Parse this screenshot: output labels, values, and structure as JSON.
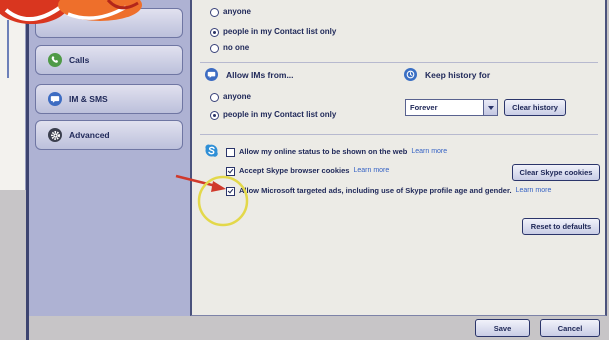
{
  "colors": {
    "window_frame": "#3d4470",
    "sidebar_bg": "#aeb2d3",
    "main_bg": "#ecebe6",
    "footer_bg": "#c7c5c7",
    "text": "#212a5a",
    "link": "#3562c4",
    "button_border": "#2b356a",
    "annotation_arrow": "#d0392b",
    "annotation_circle": "#e3d84a",
    "logo_red": "#d9361f",
    "logo_orange": "#ee6f2b"
  },
  "sidebar": {
    "items": [
      {
        "label": "Calls",
        "icon": "phone-icon",
        "icon_color": "#4f9a47"
      },
      {
        "label": "IM & SMS",
        "icon": "chat-icon",
        "icon_color": "#3d6cc2"
      },
      {
        "label": "Advanced",
        "icon": "gear-icon",
        "icon_color": "#3b3f4e"
      }
    ]
  },
  "privacy": {
    "contact_group": {
      "options": [
        {
          "label": "anyone",
          "selected": false
        },
        {
          "label": "people in my Contact list only",
          "selected": true
        },
        {
          "label": "no one",
          "selected": false
        }
      ]
    },
    "im_group": {
      "heading": "Allow IMs from...",
      "icon": "chat-icon",
      "icon_color": "#3d6cc2",
      "options": [
        {
          "label": "anyone",
          "selected": false
        },
        {
          "label": "people in my Contact list only",
          "selected": true
        }
      ]
    },
    "history": {
      "heading": "Keep history for",
      "icon": "history-icon",
      "icon_color": "#3a6fc4",
      "selected_value": "Forever",
      "clear_button": "Clear history"
    },
    "web": {
      "icon": "skype-icon",
      "checkboxes": [
        {
          "label": "Allow my online status to be shown on the web",
          "link": "Learn more",
          "checked": false
        },
        {
          "label": "Accept Skype browser cookies",
          "link": "Learn more",
          "checked": true
        },
        {
          "label": "Allow Microsoft targeted ads, including use of Skype profile age and gender.",
          "link": "Learn more",
          "checked": true
        }
      ],
      "clear_cookies_button": "Clear Skype cookies"
    },
    "reset_button": "Reset to defaults"
  },
  "footer": {
    "save_button": "Save",
    "cancel_button": "Cancel"
  }
}
